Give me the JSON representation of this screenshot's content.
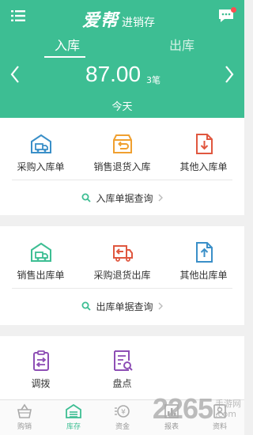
{
  "header": {
    "brand_logo": "爱帮",
    "brand_sub": "进销存",
    "tabs": [
      {
        "label": "入库",
        "active": true
      },
      {
        "label": "出库",
        "active": false
      }
    ],
    "amount": "87.00",
    "count": "3笔",
    "date_label": "今天",
    "colors": {
      "primary": "#3dbe93",
      "notification_dot": "#ff4d4f"
    }
  },
  "inbound": {
    "actions": [
      {
        "label": "采购入库单",
        "icon": "truck-warehouse-icon",
        "color": "#3a8fc8"
      },
      {
        "label": "销售退货入库",
        "icon": "return-box-icon",
        "color": "#f0a030"
      },
      {
        "label": "其他入库单",
        "icon": "download-document-icon",
        "color": "#e0573f"
      }
    ],
    "query_label": "入库单据查询"
  },
  "outbound": {
    "actions": [
      {
        "label": "销售出库单",
        "icon": "delivery-truck-icon",
        "color": "#3dbe93"
      },
      {
        "label": "采购退货出库",
        "icon": "return-truck-icon",
        "color": "#e0573f"
      },
      {
        "label": "其他出库单",
        "icon": "upload-document-icon",
        "color": "#3a8fc8"
      }
    ],
    "query_label": "出库单据查询"
  },
  "misc": {
    "actions": [
      {
        "label": "调拨",
        "icon": "transfer-clipboard-icon",
        "color": "#8e4fb5"
      },
      {
        "label": "盘点",
        "icon": "inventory-check-icon",
        "color": "#8e4fb5"
      }
    ]
  },
  "bottom_nav": [
    {
      "label": "购销",
      "icon": "basket-icon",
      "active": false
    },
    {
      "label": "库存",
      "icon": "warehouse-icon",
      "active": true
    },
    {
      "label": "资金",
      "icon": "money-icon",
      "active": false
    },
    {
      "label": "报表",
      "icon": "report-icon",
      "active": false
    },
    {
      "label": "资料",
      "icon": "profile-icon",
      "active": false
    }
  ],
  "watermark": {
    "number": "2265",
    "suffix": ".com",
    "text": "手游网"
  }
}
